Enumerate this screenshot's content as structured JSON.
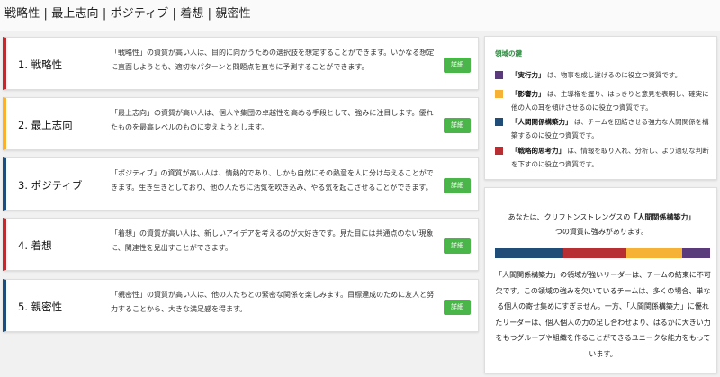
{
  "page": {
    "title": "戦略性 | 最上志向 | ポジティブ | 着想 | 親密性"
  },
  "colors": {
    "executing": "#5b3a7c",
    "influencing": "#f5b234",
    "relationship": "#1f4d78",
    "strategic": "#b72f33",
    "detail_button": "#4ab548",
    "legend_title": "#2b8a3e"
  },
  "themes": [
    {
      "title": "1. 戦略性",
      "color": "#b72f33",
      "description": "「戦略性」の資質が高い人は、目的に向かうための選択肢を想定することができます。いかなる想定に直面しようとも、適切なパターンと問題点を直ちに予測することができます。",
      "detail_label": "詳細"
    },
    {
      "title": "2. 最上志向",
      "color": "#f5b234",
      "description": "「最上志向」の資質が高い人は、個人や集団の卓越性を高める手段として、強みに注目します。優れたものを最高レベルのものに変えようとします。",
      "detail_label": "詳細"
    },
    {
      "title": "3. ポジティブ",
      "color": "#1f4d78",
      "description": "「ポジティブ」の資質が高い人は、情熱的であり、しかも自然にその熱意を人に分け与えることができます。生き生きとしており、他の人たちに活気を吹き込み、やる気を起こさせることができます。",
      "detail_label": "詳細"
    },
    {
      "title": "4. 着想",
      "color": "#b72f33",
      "description": "「着想」の資質が高い人は、新しいアイデアを考えるのが大好きです。見た目には共通点のない現象に、関連性を見出すことができます。",
      "detail_label": "詳細"
    },
    {
      "title": "5. 親密性",
      "color": "#1f4d78",
      "description": "「親密性」の資質が高い人は、他の人たちとの緊密な関係を楽しみます。目標達成のために友人と努力することから、大きな満足感を得ます。",
      "detail_label": "詳細"
    }
  ],
  "legend": {
    "title": "領域の鍵",
    "items": [
      {
        "name": "「実行力」",
        "text": " は、物事を成し遂げるのに役立つ資質です。",
        "color": "#5b3a7c"
      },
      {
        "name": "「影響力」",
        "text": " は、主導権を握り、はっきりと意見を表明し、確実に他の人の耳を傾けさせるのに役立つ資質です。",
        "color": "#f5b234"
      },
      {
        "name": "「人間関係構築力」",
        "text": " は、チームを団結させる強力な人間関係を構築するのに役立つ資質です。",
        "color": "#1f4d78"
      },
      {
        "name": "「戦略的思考力」",
        "text": " は、情報を取り入れ、分析し、より適切な判断を下すのに役立つ資質です。",
        "color": "#b72f33"
      }
    ]
  },
  "summary": {
    "prefix": "あなたは、クリフトンストレングスの",
    "domain": "「人間関係構築力」",
    "suffix": "つの資質に強みがあります。",
    "segments": [
      {
        "color": "#1f4d78",
        "share": 0.32
      },
      {
        "color": "#b72f33",
        "share": 0.29
      },
      {
        "color": "#f5b234",
        "share": 0.26
      },
      {
        "color": "#5b3a7c",
        "share": 0.13
      }
    ],
    "body": "「人間関係構築力」の領域が強いリーダーは、チームの結束に不可欠です。この領域の強みを欠いているチームは、多くの場合、単なる個人の寄せ集めにすぎません。一方、「人間関係構築力」に優れたリーダーは、個人個人の力の足し合わせより、はるかに大きい力をもつグループや組織を作ることができるユニークな能力をもっています。"
  }
}
